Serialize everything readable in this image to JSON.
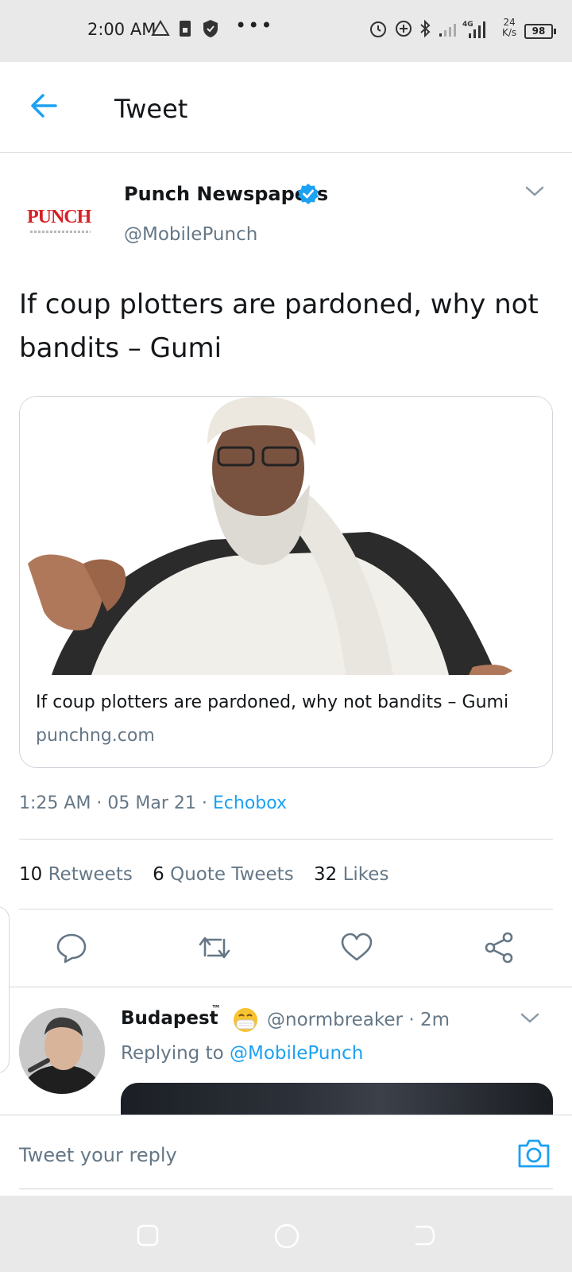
{
  "status_bar": {
    "time": "2:00 AM",
    "net_speed_value": "24",
    "net_speed_unit": "K/s",
    "network_type": "4G",
    "battery": "98"
  },
  "header": {
    "title": "Tweet"
  },
  "tweet": {
    "author_name": "Punch Newspapers",
    "author_handle": "@MobilePunch",
    "logo_text": "PUNCH",
    "text": "If coup plotters are pardoned, why not bandits – Gumi",
    "card": {
      "title": "If coup plotters are pardoned, why not bandits – Gumi",
      "domain": "punchng.com"
    },
    "time": "1:25 AM · 05 Mar 21 · ",
    "source": "Echobox",
    "stats": {
      "retweets_count": "10",
      "retweets_label": "Retweets",
      "quotes_count": "6",
      "quotes_label": "Quote Tweets",
      "likes_count": "32",
      "likes_label": "Likes"
    }
  },
  "reply": {
    "author_name": "Budapest",
    "tm": "™",
    "handle_time": "@normbreaker · 2m",
    "replying_prefix": "Replying to ",
    "replying_handle": "@MobilePunch"
  },
  "composer": {
    "placeholder": "Tweet your reply"
  },
  "colors": {
    "accent": "#1da1f2",
    "secondary_text": "#657786",
    "brand_red": "#d62027"
  }
}
